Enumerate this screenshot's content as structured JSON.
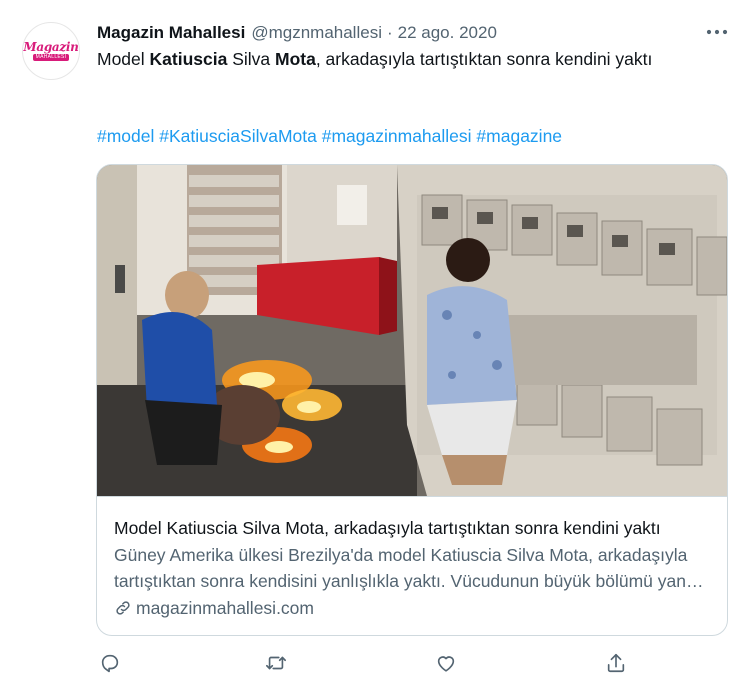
{
  "tweet": {
    "author_name": "Magazin Mahallesi",
    "author_handle": "@mgznmahallesi",
    "separator": "·",
    "date": "22 ago. 2020",
    "avatar_logo_top": "Magazin",
    "avatar_logo_bottom": "MAHALLESİ",
    "text_parts": [
      "Model ",
      "Katiuscia",
      " Silva ",
      "Mota",
      ", arkadaşıyla tartıştıktan sonra kendini yaktı"
    ],
    "hashtags": [
      "#model",
      "#KatiusciaSilvaMota",
      "#magazinmahallesi",
      "#magazine"
    ]
  },
  "card": {
    "title": "Model Katiuscia Silva Mota, arkadaşıyla tartıştıktan sonra kendini yaktı",
    "description": "Güney Amerika ülkesi Brezilya'da model Katiuscia Silva Mota, arkadaşıyla tartıştıktan sonra kendisini yanlışlıkla yaktı. Vücudunun büyük bölümü yanan model hastaneye kaldırıldı.",
    "domain": "magazinmahallesi.com"
  },
  "icons": {
    "more": "more-horizontal-icon",
    "reply": "reply-icon",
    "retweet": "retweet-icon",
    "like": "like-icon",
    "share": "share-icon",
    "link": "link-icon"
  },
  "colors": {
    "link_blue": "#1d9bf0",
    "secondary_text": "#536471",
    "border": "#cfd9de",
    "brand_pink": "#d81b7a"
  }
}
